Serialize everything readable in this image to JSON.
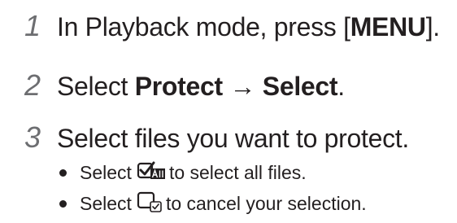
{
  "steps": [
    {
      "number": "1",
      "prefix": "In Playback mode, press [",
      "bold": "MENU",
      "suffix": "]."
    },
    {
      "number": "2",
      "prefix": "Select ",
      "bold1": "Protect",
      "arrow": " → ",
      "bold2": "Select",
      "suffix": "."
    },
    {
      "number": "3",
      "text": "Select files you want to protect."
    }
  ],
  "bullets": [
    {
      "before": "Select",
      "icon": "select-all-files-icon",
      "after": "to select all files."
    },
    {
      "before": "Select",
      "icon": "cancel-selection-icon",
      "after": "to cancel your selection."
    }
  ]
}
